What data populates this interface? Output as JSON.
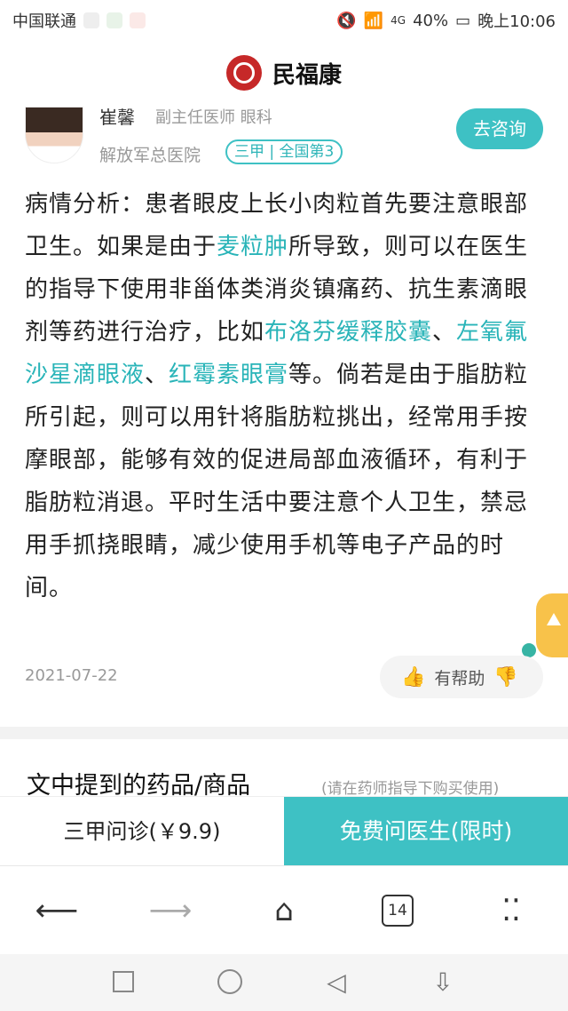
{
  "status_bar": {
    "carrier": "中国联通",
    "network": "4G",
    "battery": "40%",
    "time": "晚上10:06"
  },
  "app": {
    "name": "民福康"
  },
  "doctor": {
    "name": "崔馨",
    "title": "副主任医师 眼科",
    "hospital": "解放军总医院",
    "badge": "三甲 | 全国第3",
    "consult_label": "去咨询"
  },
  "article": {
    "p1": "病情分析：患者眼皮上长小肉粒首先要注意眼部卫生。如果是由于",
    "link1": "麦粒肿",
    "p2": "所导致，则可以在医生的指导下使用非甾体类消炎镇痛药、抗生素滴眼剂等药进行治疗，比如",
    "link2": "布洛芬缓释胶囊",
    "sep1": "、",
    "link3": "左氧氟沙星滴眼液",
    "sep2": "、",
    "link4": "红霉素眼膏",
    "p3": "等。倘若是由于脂肪粒所引起，则可以用针将脂肪粒挑出，经常用手按摩眼部，能够有效的促进局部血液循环，有利于脂肪粒消退。平时生活中要注意个人卫生，禁忌用手抓挠眼睛，减少使用手机等电子产品的时间。",
    "date": "2021-07-22",
    "helpful_label": "有帮助"
  },
  "products_section": {
    "title": "文中提到的药品/商品",
    "note": "(请在药师指导下购买使用)"
  },
  "cta": {
    "left_label": "三甲问诊(￥9.9)",
    "right_label": "免费问医生(限时)"
  },
  "browser": {
    "tab_count": "14"
  },
  "colors": {
    "accent": "#3ec1c4",
    "link": "#29b4b8"
  }
}
